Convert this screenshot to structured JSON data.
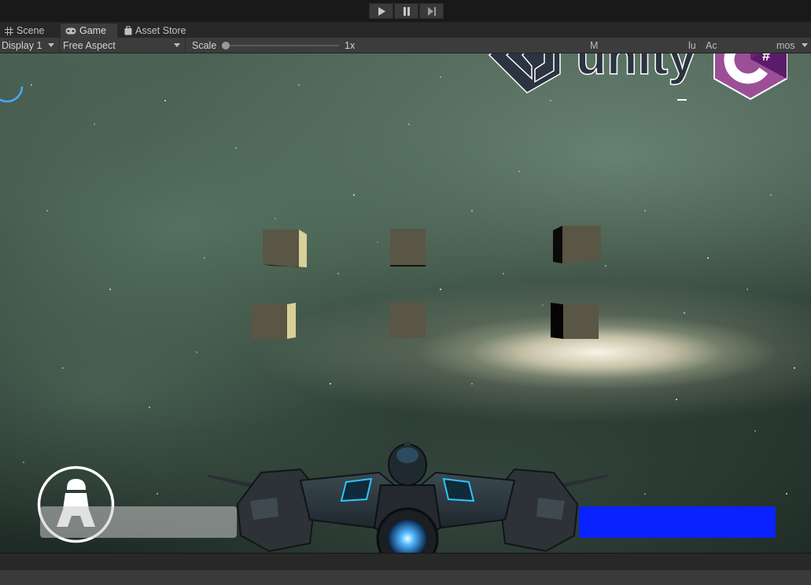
{
  "playbar": {
    "play_icon": "play-icon",
    "pause_icon": "pause-icon",
    "step_icon": "step-icon"
  },
  "tabs": [
    {
      "label": "Scene",
      "icon": "grid-icon"
    },
    {
      "label": "Game",
      "icon": "gamepad-icon",
      "active": true
    },
    {
      "label": "Asset Store",
      "icon": "bag-icon"
    }
  ],
  "toolbar": {
    "display": "Display 1",
    "aspect": "Free Aspect",
    "scale_label": "Scale",
    "scale_value": "1x",
    "right_fragments": [
      "M",
      "lu",
      "Ac",
      "mos"
    ]
  },
  "logos": {
    "unity": "unity",
    "csharp": "C#"
  },
  "colors": {
    "editor_bg": "#282828",
    "toolbar_bg": "#3c3c3c",
    "right_bar": "#0a22ff",
    "left_bar": "#c8c8c8",
    "cube_face": "#5a5645",
    "cube_side": "#d8d09a",
    "csharp_purple": "#68217a"
  },
  "game": {
    "thrust_icon": "rocket-icon",
    "cube_count": 6
  }
}
